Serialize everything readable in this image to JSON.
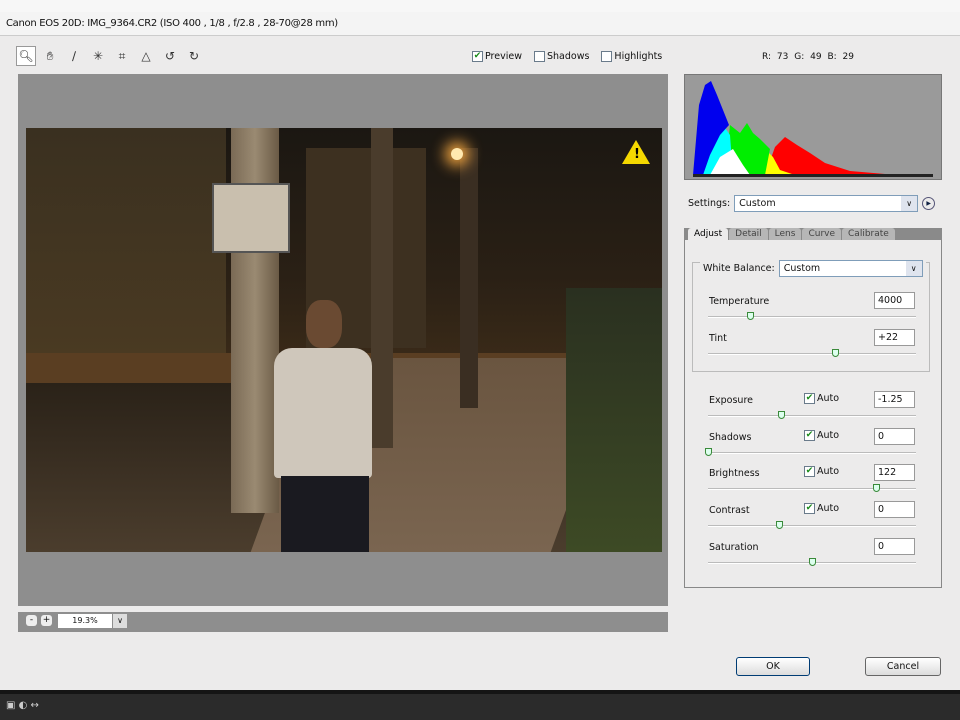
{
  "window": {
    "title": "Canon EOS 20D:  IMG_9364.CR2  (ISO 400 , 1/8 , f/2.8 , 28-70@28 mm)"
  },
  "toolbar": {
    "tools": [
      "zoom-icon",
      "hand-icon",
      "white-balance-eyedropper-icon",
      "color-sampler-icon",
      "crop-icon",
      "straighten-icon",
      "rotate-left-icon",
      "rotate-right-icon"
    ]
  },
  "preview_options": [
    {
      "label": "Preview",
      "checked": true
    },
    {
      "label": "Shadows",
      "checked": false
    },
    {
      "label": "Highlights",
      "checked": false
    }
  ],
  "readout": {
    "r_label": "R:",
    "r": "73",
    "g_label": "G:",
    "g": "49",
    "b_label": "B:",
    "b": "29"
  },
  "zoom": {
    "value": "19.3%"
  },
  "settings": {
    "label": "Settings:",
    "value": "Custom"
  },
  "tabs": [
    {
      "label": "Adjust",
      "active": true
    },
    {
      "label": "Detail"
    },
    {
      "label": "Lens"
    },
    {
      "label": "Curve"
    },
    {
      "label": "Calibrate"
    }
  ],
  "white_balance": {
    "label": "White Balance:",
    "value": "Custom"
  },
  "sliders": [
    {
      "label": "Temperature",
      "value": "4000",
      "level": 0.2,
      "auto": null
    },
    {
      "label": "Tint",
      "value": "+22",
      "level": 0.61,
      "auto": null
    },
    {
      "label": "Exposure",
      "value": "-1.25",
      "level": 0.35,
      "auto": true
    },
    {
      "label": "Shadows",
      "value": "0",
      "level": 0.0,
      "auto": true
    },
    {
      "label": "Brightness",
      "value": "122",
      "level": 0.81,
      "auto": true
    },
    {
      "label": "Contrast",
      "value": "0",
      "level": 0.34,
      "auto": true
    },
    {
      "label": "Saturation",
      "value": "0",
      "level": 0.5,
      "auto": null
    }
  ],
  "auto_label": "Auto",
  "buttons": {
    "ok": "OK",
    "cancel": "Cancel"
  },
  "colors": {
    "accent": "#003c74",
    "checkmark": "#1a8a1a",
    "warning": "#f5d800"
  }
}
